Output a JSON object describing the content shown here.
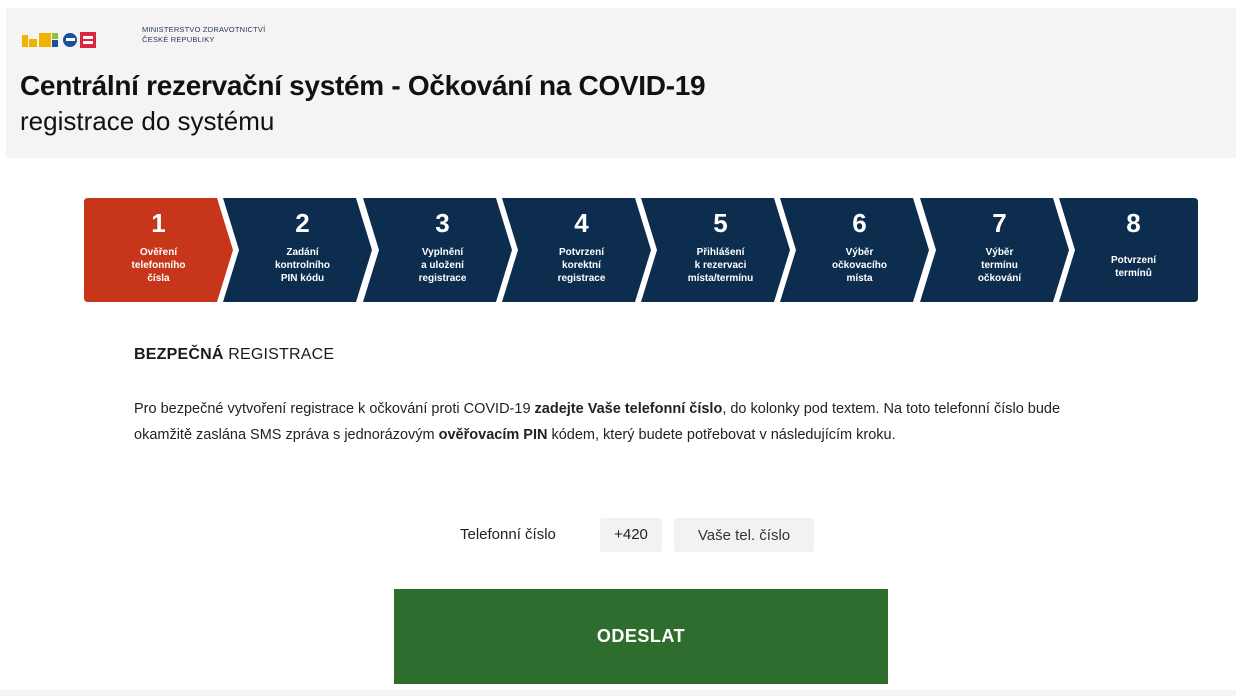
{
  "header": {
    "ministry_line1": "MINISTERSTVO ZDRAVOTNICTVÍ",
    "ministry_line2": "ČESKÉ REPUBLIKY",
    "title": "Centrální rezervační systém - Očkování na COVID-19",
    "subtitle": "registrace do systému"
  },
  "colors": {
    "active_step": "#c7361b",
    "step": "#0d2d4f",
    "submit": "#2e6d2e"
  },
  "steps": [
    {
      "num": "1",
      "label": "Ověření\ntelefonního\nčísla",
      "active": true
    },
    {
      "num": "2",
      "label": "Zadání\nkontrolního\nPIN kódu",
      "active": false
    },
    {
      "num": "3",
      "label": "Vyplnění\na uložení\nregistrace",
      "active": false
    },
    {
      "num": "4",
      "label": "Potvrzení\nkorektní\nregistrace",
      "active": false
    },
    {
      "num": "5",
      "label": "Přihlášení\nk rezervaci\nmísta/termínu",
      "active": false
    },
    {
      "num": "6",
      "label": "Výběr\nočkovacího\nmísta",
      "active": false
    },
    {
      "num": "7",
      "label": "Výběr\ntermínu\nočkování",
      "active": false
    },
    {
      "num": "8",
      "label": "Potvrzení\ntermínů",
      "active": false
    }
  ],
  "section": {
    "title_bold": "BEZPEČNÁ",
    "title_rest": " REGISTRACE"
  },
  "description": {
    "p1": "Pro bezpečné vytvoření registrace k očkování proti COVID-19 ",
    "p1_bold": "zadejte Vaše telefonní číslo",
    "p2": ", do kolonky pod textem. Na toto telefonní číslo bude okamžitě zaslána SMS zpráva s jednorázovým ",
    "p2_bold": "ověřovacím PIN",
    "p3": " kódem, který budete potřebovat v následujícím kroku."
  },
  "form": {
    "tel_label": "Telefonní číslo",
    "prefix": "+420",
    "phone_placeholder": "Vaše tel. číslo",
    "submit_label": "ODESLAT"
  }
}
